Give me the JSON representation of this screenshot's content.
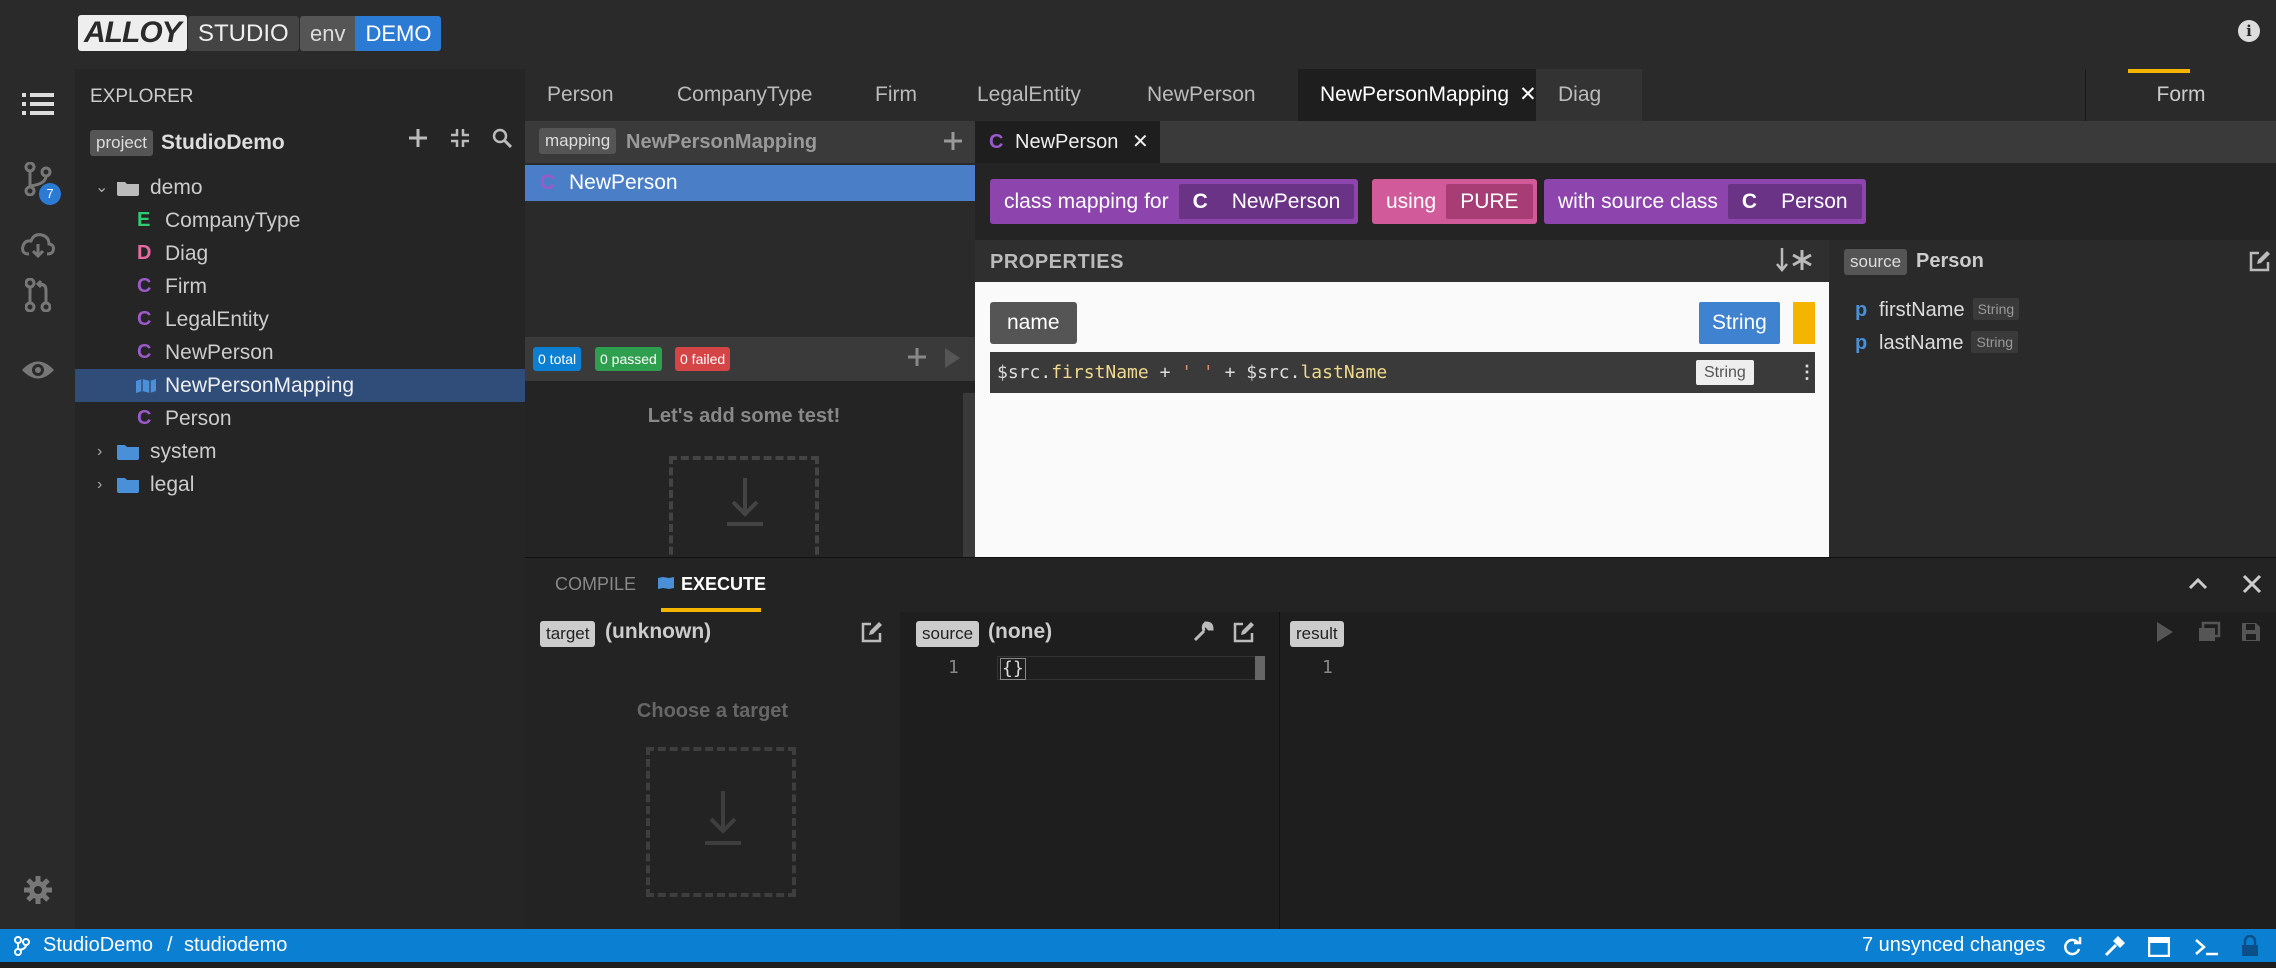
{
  "header": {
    "logo_text": "ALLOY",
    "studio_label": "STUDIO",
    "env_label": "env",
    "env_value": "DEMO"
  },
  "activity_bar": {
    "review_badge": "7"
  },
  "explorer": {
    "title": "EXPLORER",
    "project_tag": "project",
    "project_name": "StudioDemo",
    "tree": [
      {
        "label": "demo",
        "kind": "folder-open"
      },
      {
        "label": "CompanyType",
        "kind": "E"
      },
      {
        "label": "Diag",
        "kind": "D"
      },
      {
        "label": "Firm",
        "kind": "C"
      },
      {
        "label": "LegalEntity",
        "kind": "C"
      },
      {
        "label": "NewPerson",
        "kind": "C"
      },
      {
        "label": "NewPersonMapping",
        "kind": "mapping",
        "selected": true
      },
      {
        "label": "Person",
        "kind": "C"
      },
      {
        "label": "system",
        "kind": "folder"
      },
      {
        "label": "legal",
        "kind": "folder"
      }
    ]
  },
  "tabs": {
    "items": [
      "Person",
      "CompanyType",
      "Firm",
      "LegalEntity",
      "NewPerson",
      "NewPersonMapping",
      "Diag"
    ],
    "active": "NewPersonMapping",
    "close_glyph": "✕",
    "form_tab": "Form"
  },
  "mapping_explorer": {
    "tag": "mapping",
    "title": "NewPersonMapping",
    "item_kind": "C",
    "item": "NewPerson",
    "tests": {
      "total": "0 total",
      "passed": "0 passed",
      "failed": "0 failed",
      "empty_message": "Let's add some test!"
    }
  },
  "editor": {
    "tab_kind": "C",
    "tab_label": "NewPerson",
    "header": {
      "class_mapping_for": "class mapping for",
      "target_kind": "C",
      "target": "NewPerson",
      "using": "using",
      "mapping_type": "PURE",
      "with_source_class": "with source class",
      "source_kind": "C",
      "source": "Person"
    },
    "properties_title": "PROPERTIES",
    "property": {
      "name": "name",
      "type": "String",
      "expression_parts": [
        "$src.",
        "firstName",
        " + ",
        "' '",
        " + ",
        "$src.",
        "lastName"
      ],
      "expression_type": "String"
    },
    "source_panel": {
      "tag": "source",
      "class_name": "Person",
      "properties": [
        {
          "kind": "p",
          "name": "firstName",
          "type": "String"
        },
        {
          "kind": "p",
          "name": "lastName",
          "type": "String"
        }
      ]
    }
  },
  "bottom_panel": {
    "tabs": [
      "COMPILE",
      "EXECUTE"
    ],
    "active_tab": "EXECUTE",
    "target": {
      "tag": "target",
      "value": "(unknown)",
      "empty_message": "Choose a target"
    },
    "source": {
      "tag": "source",
      "value": "(none)",
      "line": "1",
      "code": "{}"
    },
    "result": {
      "tag": "result",
      "line": "1"
    }
  },
  "status_bar": {
    "workspace": "StudioDemo",
    "separator": "/",
    "branch": "studiodemo",
    "changes": "7 unsynced changes"
  },
  "colors": {
    "accent_blue": "#2b7bd5",
    "status_bar": "#0b7fd1",
    "active_tab_underline": "#f5b400",
    "class_purple": "#9b59c9",
    "mapping_chip": "#8e44ad",
    "pure_chip": "#d15b9a",
    "enum_green": "#2ecc71",
    "diagram_pink": "#e86aa0"
  }
}
